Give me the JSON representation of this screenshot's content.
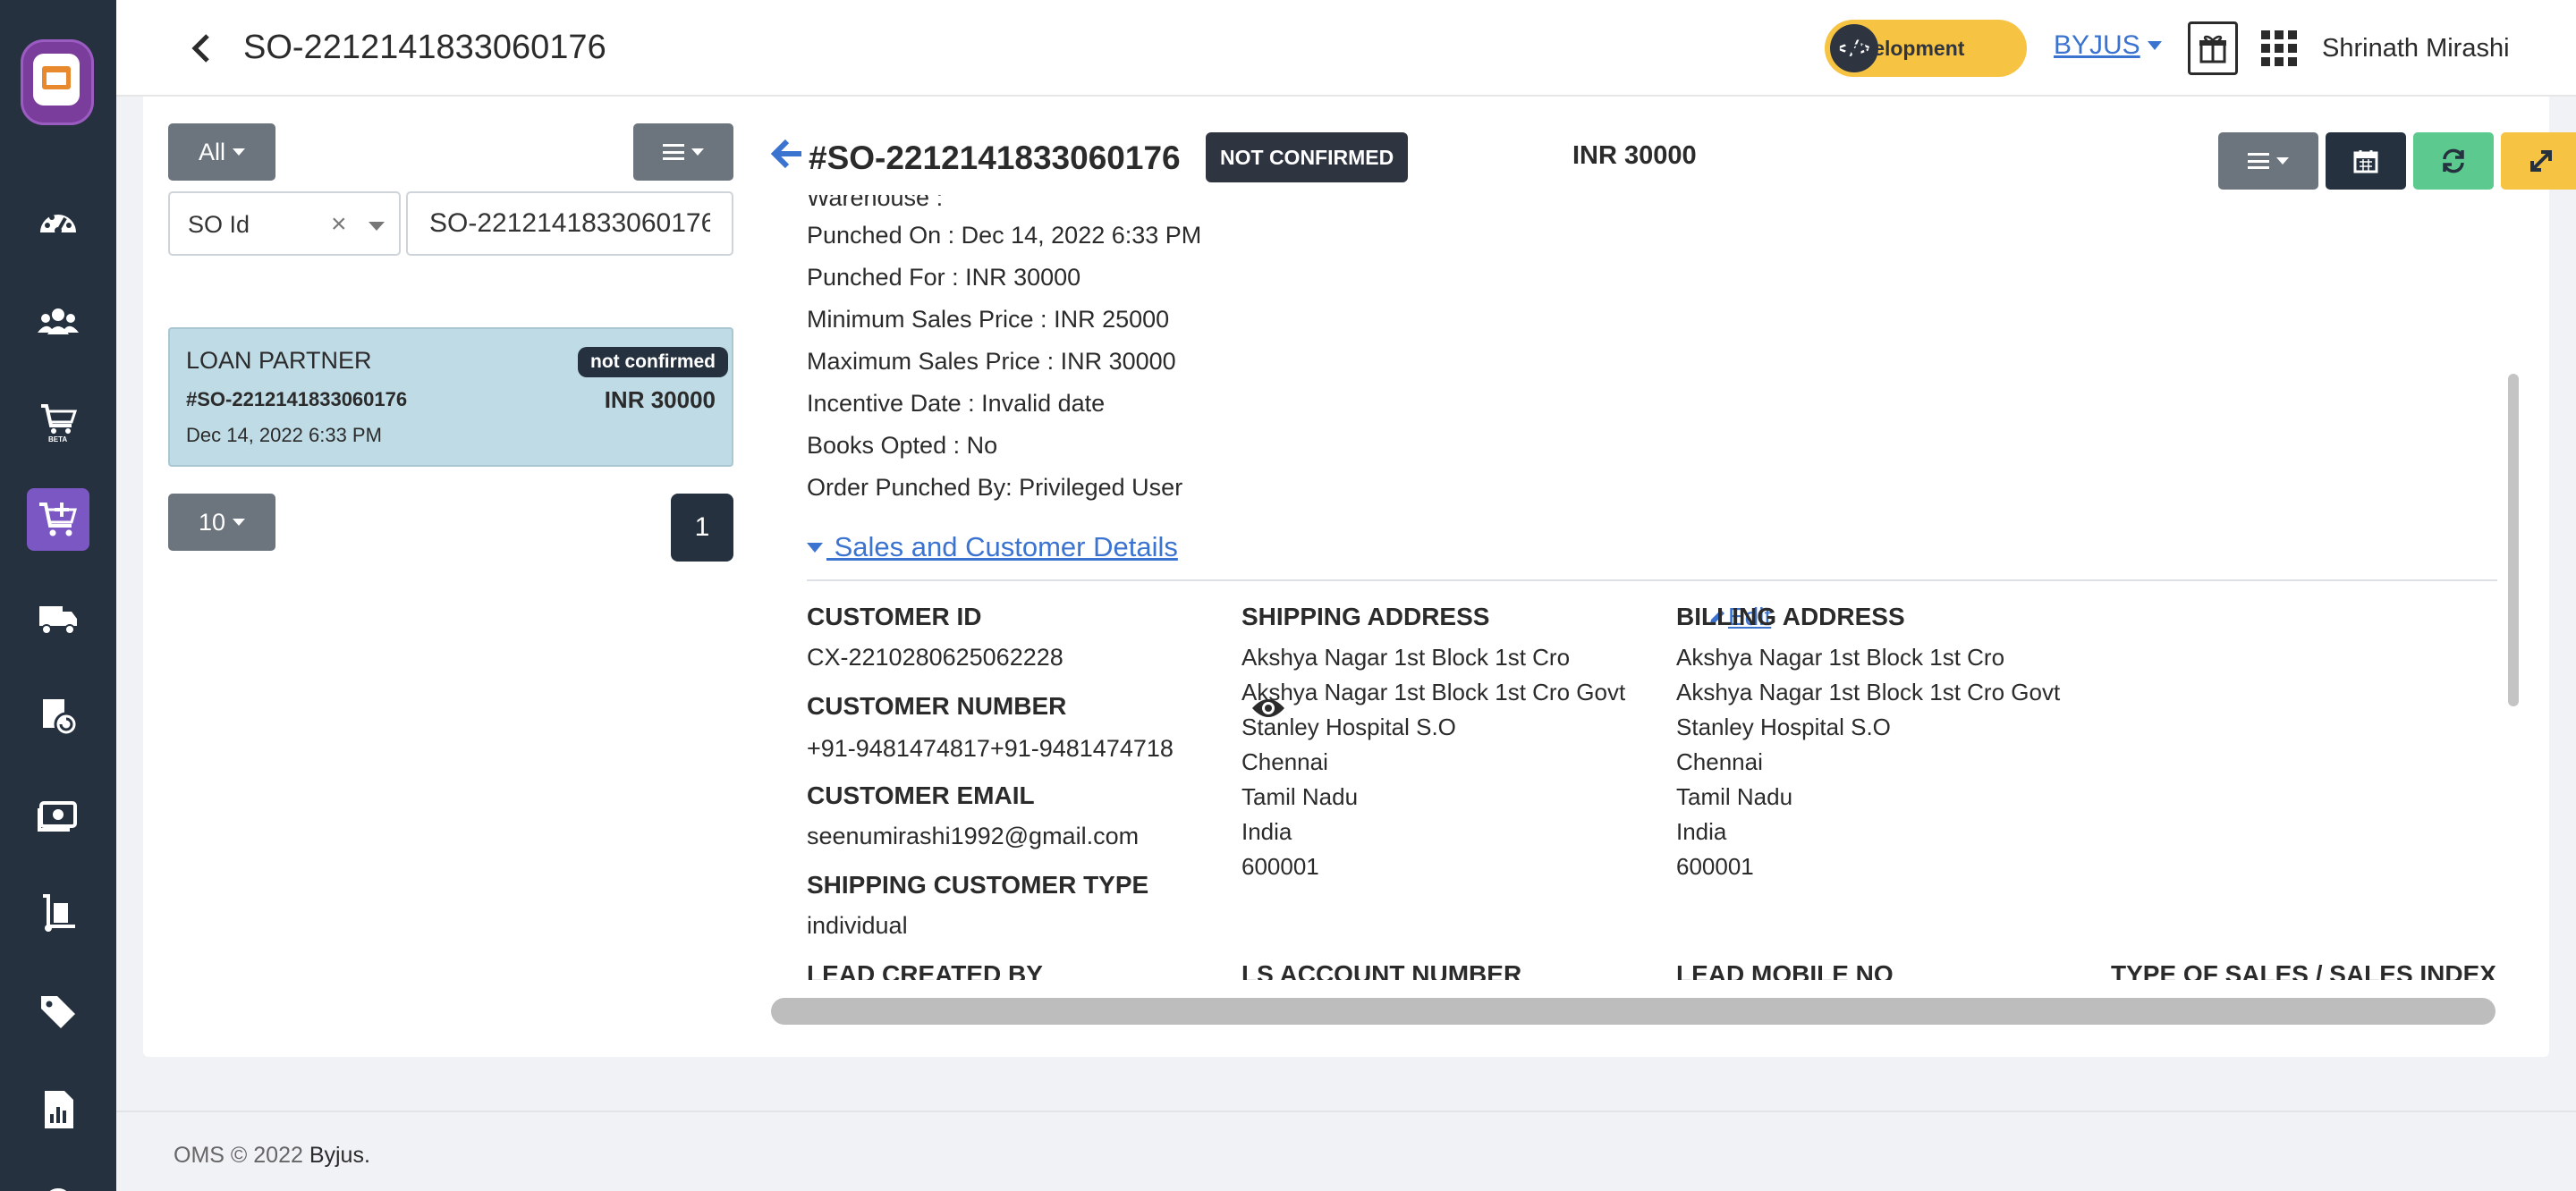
{
  "header": {
    "title": "SO-2212141833060176",
    "env_badge": "Development",
    "org": "BYJUS",
    "user": "Shrinath Mirashi"
  },
  "sidebar": {
    "items": [
      {
        "name": "dashboard-icon",
        "active": false
      },
      {
        "name": "users-icon",
        "active": false
      },
      {
        "name": "beta-cart-icon",
        "active": false
      },
      {
        "name": "add-cart-icon",
        "active": true
      },
      {
        "name": "delivery-truck-icon",
        "active": false
      },
      {
        "name": "box-return-icon",
        "active": false
      },
      {
        "name": "payments-icon",
        "active": false
      },
      {
        "name": "hand-truck-icon",
        "active": false
      },
      {
        "name": "tag-icon",
        "active": false
      },
      {
        "name": "report-icon",
        "active": false
      }
    ]
  },
  "left_pane": {
    "filter_label": "All",
    "search_field": "SO Id",
    "search_value": "SO-2212141833060176",
    "order": {
      "partner_type": "LOAN PARTNER",
      "status": "not confirmed",
      "so_id": "#SO-2212141833060176",
      "amount": "INR 30000",
      "date": "Dec 14, 2022 6:33 PM"
    },
    "per_page": "10",
    "current_page": "1"
  },
  "detail": {
    "so_id": "#SO-2212141833060176",
    "status": "NOT CONFIRMED",
    "amount": "INR 30000",
    "info": [
      "Warehouse :",
      "Punched On : Dec 14, 2022 6:33 PM",
      "Punched For : INR 30000",
      "Minimum Sales Price : INR 25000",
      "Maximum Sales Price : INR 30000",
      "Incentive Date : Invalid date",
      "Books Opted : No",
      "Order Punched By: Privileged User"
    ],
    "section_title": " Sales and Customer Details",
    "customer_id_label": "CUSTOMER ID",
    "customer_id": "CX-2210280625062228",
    "customer_number_label": "CUSTOMER NUMBER",
    "customer_number": "+91-9481474817+91-9481474718",
    "customer_email_label": "CUSTOMER EMAIL",
    "customer_email": "seenumirashi1992@gmail.com",
    "shipping_type_label": "SHIPPING CUSTOMER TYPE",
    "shipping_type": "individual",
    "shipping_address_label": "SHIPPING ADDRESS",
    "edit_label": "Edit",
    "shipping_address": [
      "Akshya Nagar 1st Block 1st Cro",
      "Akshya Nagar 1st Block 1st Cro Govt",
      "Stanley Hospital S.O",
      "Chennai",
      "Tamil Nadu",
      "India",
      "600001"
    ],
    "billing_address_label": "BILLING ADDRESS",
    "billing_address": [
      "Akshya Nagar 1st Block 1st Cro",
      "Akshya Nagar 1st Block 1st Cro Govt",
      "Stanley Hospital S.O",
      "Chennai",
      "Tamil Nadu",
      "India",
      "600001"
    ],
    "lead_created_by_label": "LEAD CREATED BY",
    "ls_account_label": "LS ACCOUNT NUMBER",
    "lead_mobile_label": "LEAD MOBILE NO",
    "type_of_sales_label": "TYPE OF SALES / SALES INDEX"
  },
  "footer": {
    "text": "OMS © 2022 ",
    "brand": "Byjus."
  },
  "colors": {
    "sidebar": "#25313f",
    "accent": "#7b57c4",
    "link": "#3b73d1",
    "badge_dev": "#f6c343",
    "btn_green": "#5cc98e",
    "btn_yellow": "#f6c343",
    "btn_red": "#e2495a"
  }
}
